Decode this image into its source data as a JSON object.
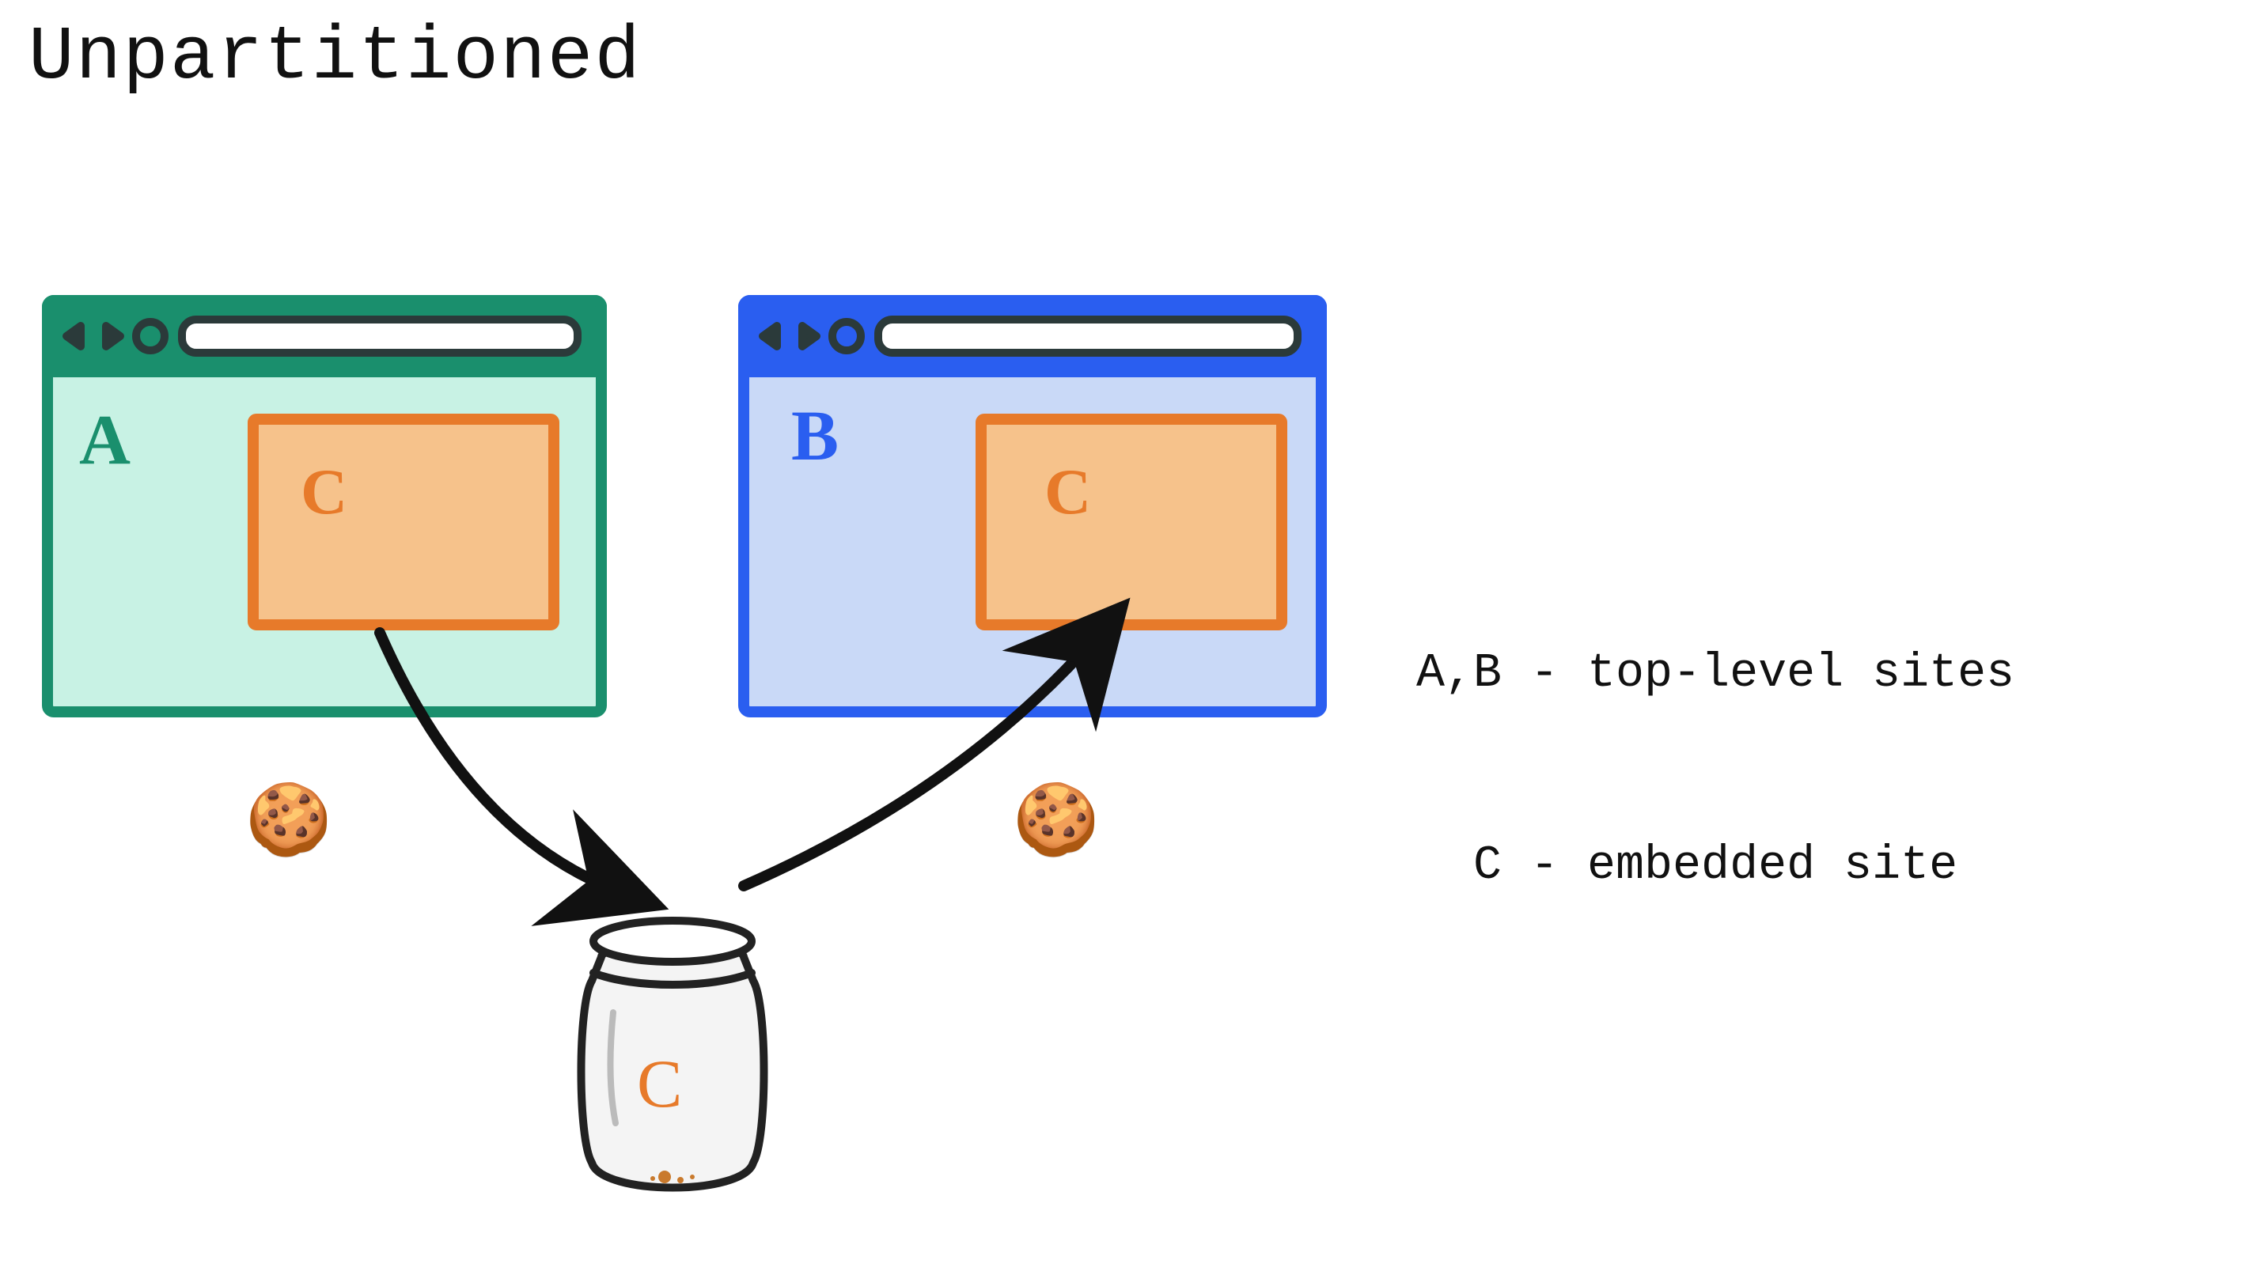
{
  "title": "Unpartitioned",
  "legend": {
    "line1": "A,B - top-level sites",
    "line2": "  C - embedded site"
  },
  "browsers": {
    "a": {
      "label": "A",
      "embedded_label": "C"
    },
    "b": {
      "label": "B",
      "embedded_label": "C"
    }
  },
  "jar": {
    "label": "C"
  },
  "cookies": {
    "left": "🍪",
    "right": "🍪"
  },
  "colors": {
    "browser_a_stroke": "#1a8f6d",
    "browser_a_fill": "#c8f2e4",
    "browser_b_stroke": "#2a5ef0",
    "browser_b_fill": "#c9d9f7",
    "embedded_stroke": "#e77a2a",
    "embedded_fill": "#f6c28b",
    "ink": "#111111"
  }
}
